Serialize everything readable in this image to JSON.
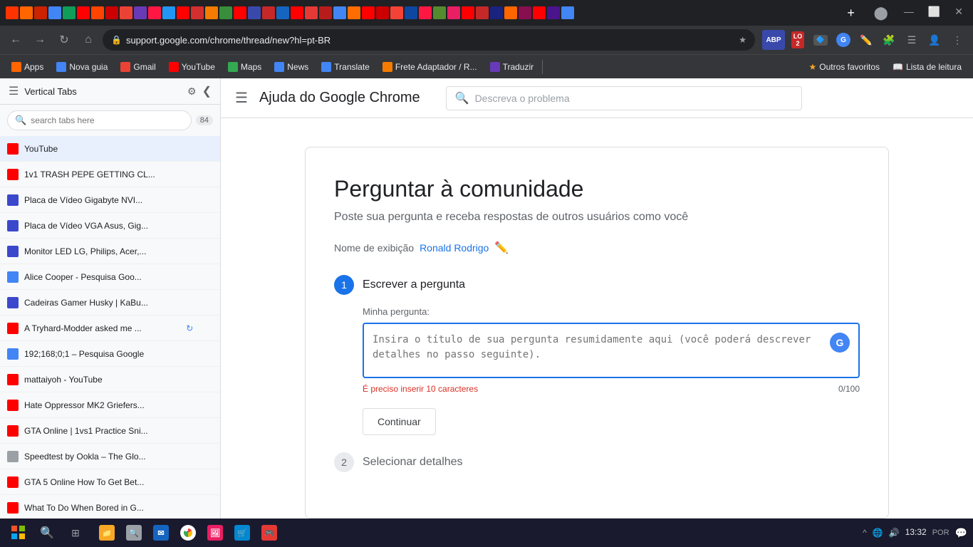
{
  "browser": {
    "address": "support.google.com/chrome/thread/new?hl=pt-BR",
    "title": "Ajuda do Google Chrome"
  },
  "bookmarks": {
    "items": [
      {
        "label": "Apps",
        "color": "bm-red",
        "icon": "⊞"
      },
      {
        "label": "Nova guia",
        "color": "bm-blue",
        "icon": ""
      },
      {
        "label": "Gmail",
        "color": "bm-red",
        "icon": "M"
      },
      {
        "label": "YouTube",
        "color": "bm-red",
        "icon": "▶"
      },
      {
        "label": "Maps",
        "color": "bm-green",
        "icon": "📍"
      },
      {
        "label": "News",
        "color": "bm-blue",
        "icon": "N"
      },
      {
        "label": "Translate",
        "color": "bm-blue",
        "icon": "T"
      },
      {
        "label": "Frete Adaptador / R...",
        "color": "bm-orange",
        "icon": "🛒"
      },
      {
        "label": "Traduzir",
        "color": "bm-purple",
        "icon": "T"
      }
    ],
    "right_items": [
      {
        "label": "Outros favoritos"
      },
      {
        "label": "Lista de leitura"
      }
    ]
  },
  "sidebar": {
    "title": "Vertical Tabs",
    "search_placeholder": "search tabs here",
    "tab_count": "84",
    "tabs": [
      {
        "label": "YouTube",
        "favicon_color": "#ff0000",
        "active": true
      },
      {
        "label": "1v1 TRASH PEPE GETTING CL...",
        "favicon_color": "#ff0000"
      },
      {
        "label": "Placa de Vídeo Gigabyte NVI...",
        "favicon_color": "#3b48cc"
      },
      {
        "label": "Placa de Vídeo VGA Asus, Gig...",
        "favicon_color": "#3b48cc"
      },
      {
        "label": "Monitor LED LG, Philips, Acer,...",
        "favicon_color": "#3b48cc"
      },
      {
        "label": "Alice Cooper - Pesquisa Goo...",
        "favicon_color": "#4285f4"
      },
      {
        "label": "Cadeiras Gamer Husky | KaBu...",
        "favicon_color": "#3b48cc"
      },
      {
        "label": "A Tryhard-Modder asked me ... 🔄",
        "favicon_color": "#ff0000",
        "loading": true
      },
      {
        "label": "192;168;0;1 – Pesquisa Google",
        "favicon_color": "#4285f4"
      },
      {
        "label": "mattaiyoh - YouTube",
        "favicon_color": "#ff0000"
      },
      {
        "label": "Hate Oppressor MK2 Griefers...",
        "favicon_color": "#ff0000"
      },
      {
        "label": "GTA Online | 1vs1 Practice Sni...",
        "favicon_color": "#ff0000"
      },
      {
        "label": "Speedtest by Ookla – The Glo...",
        "favicon_color": "#9aa0a6"
      },
      {
        "label": "GTA 5 Online How To Get Bet...",
        "favicon_color": "#ff0000"
      },
      {
        "label": "What To Do When Bored in G...",
        "favicon_color": "#ff0000"
      }
    ]
  },
  "page": {
    "header_title": "Ajuda do Google Chrome",
    "search_placeholder": "Descreva o problema",
    "community_title": "Perguntar à comunidade",
    "community_subtitle": "Poste sua pergunta e receba respostas de outros usuários como você",
    "display_name_label": "Nome de exibição",
    "display_name_value": "Ronald Rodrigo",
    "step1_number": "1",
    "step1_title": "Escrever a pergunta",
    "question_label": "Minha pergunta:",
    "question_placeholder": "Insira o título de sua pergunta resumidamente aqui (você poderá descrever detalhes no passo seguinte).",
    "error_text": "É preciso inserir 10 caracteres",
    "char_count": "0/100",
    "continue_btn": "Continuar",
    "step2_number": "2",
    "step2_title": "Selecionar detalhes"
  },
  "taskbar": {
    "time": "13:32",
    "lang": "POR",
    "search_placeholder": "🔍"
  }
}
